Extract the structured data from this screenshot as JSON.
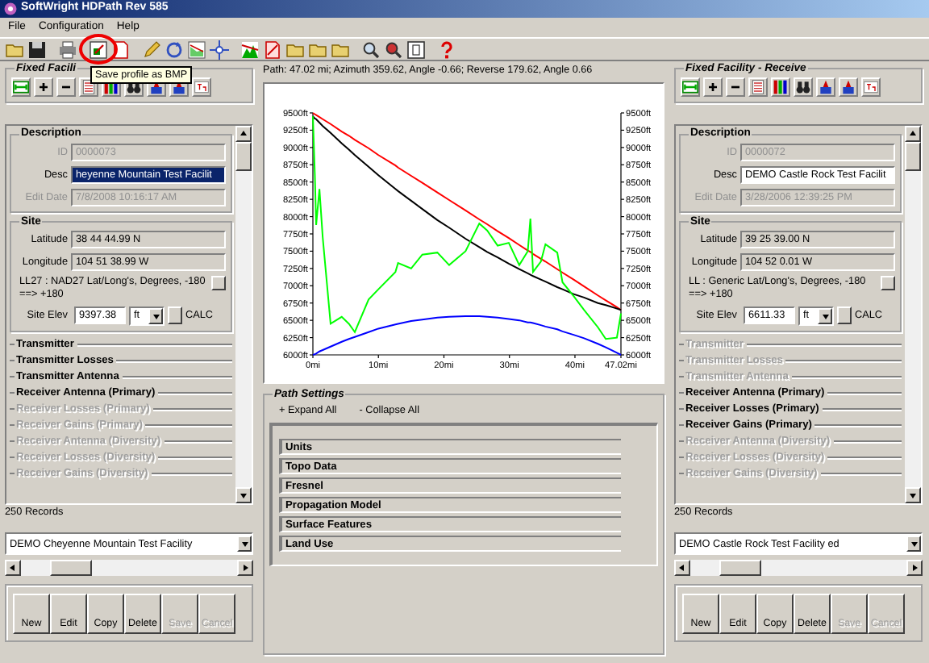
{
  "window": {
    "title": "SoftWright HDPath Rev 585"
  },
  "menu": [
    {
      "label": "File"
    },
    {
      "label": "Configuration"
    },
    {
      "label": "Help"
    }
  ],
  "toolbar": {
    "tooltip": "Save profile as BMP",
    "highlight_circle": true
  },
  "left_facility": {
    "title": "Fixed Facili",
    "description": {
      "heading": "Description",
      "fields": [
        {
          "label": "ID",
          "value": "0000073",
          "disabled": true,
          "text_selected": false
        },
        {
          "label": "Desc",
          "value": "heyenne Mountain Test Facilit",
          "disabled": false,
          "text_selected": true
        },
        {
          "label": "Edit Date",
          "value": "7/8/2008 10:16:17 AM",
          "disabled": true,
          "text_selected": false
        }
      ]
    },
    "site": {
      "heading": "Site",
      "fields": [
        {
          "label": "Latitude",
          "value": "38 44 44.99 N",
          "disabled": false,
          "readonly": true,
          "text_selected": false
        },
        {
          "label": "Longitude",
          "value": "104 51 38.99 W",
          "disabled": false,
          "readonly": true,
          "text_selected": false
        }
      ],
      "datum": "LL27 : NAD27 Lat/Long's, Degrees, -180 ==> +180",
      "elev_label": "Site Elev",
      "elev": "9397.38",
      "unit": "ft",
      "calc_label": "CALC"
    },
    "sections": [
      {
        "label": "Transmitter",
        "disabled": false
      },
      {
        "label": "Transmitter Losses",
        "disabled": false
      },
      {
        "label": "Transmitter Antenna",
        "disabled": false
      },
      {
        "label": "Receiver Antenna (Primary)",
        "disabled": false
      },
      {
        "label": "Receiver Losses (Primary)",
        "disabled": true
      },
      {
        "label": "Receiver Gains (Primary)",
        "disabled": true
      },
      {
        "label": "Receiver Antenna (Diversity)",
        "disabled": true
      },
      {
        "label": "Receiver Losses (Diversity)",
        "disabled": true
      },
      {
        "label": "Receiver Gains (Diversity)",
        "disabled": true
      }
    ],
    "records": "250 Records",
    "record": "DEMO Cheyenne Mountain Test Facility",
    "buttons": [
      {
        "label": "New",
        "disabled": false
      },
      {
        "label": "Edit",
        "disabled": false
      },
      {
        "label": "Copy",
        "disabled": false
      },
      {
        "label": "Delete",
        "disabled": false
      },
      {
        "label": "Save",
        "disabled": true
      },
      {
        "label": "Cancel",
        "disabled": true
      }
    ]
  },
  "center": {
    "path_info": "Path: 47.02 mi; Azimuth 359.62, Angle -0.66; Reverse 179.62, Angle 0.66",
    "chart": {
      "chart_data": {
        "type": "line",
        "x": [
          0,
          0.3,
          0.5,
          1,
          1.5,
          2.7,
          4.4,
          5.5,
          6.4,
          8.5,
          10,
          12.6,
          13,
          15,
          16.7,
          19,
          20.8,
          23.3,
          25.4,
          26.6,
          28.2,
          29.9,
          31.5,
          32.8,
          33.2,
          33.6,
          34.8,
          35.5,
          37.3,
          38.1,
          39.8,
          41.4,
          43.5,
          44.7,
          46.4,
          47.02
        ],
        "series": [
          {
            "color": "#ff0000",
            "values": [
              9500,
              9480,
              9470,
              9440,
              9410,
              9340,
              9230,
              9170,
              9110,
              8990,
              8890,
              8740,
              8710,
              8590,
              8490,
              8350,
              8240,
              8090,
              7960,
              7890,
              7790,
              7690,
              7590,
              7510,
              7490,
              7460,
              7390,
              7350,
              7240,
              7190,
              7090,
              6990,
              6860,
              6790,
              6690,
              6650
            ]
          },
          {
            "color": "#000000",
            "values": [
              9450,
              9420,
              9410,
              9360,
              9310,
              9210,
              9060,
              8970,
              8890,
              8720,
              8600,
              8400,
              8370,
              8230,
              8110,
              7950,
              7840,
              7680,
              7560,
              7490,
              7410,
              7320,
              7240,
              7180,
              7160,
              7140,
              7090,
              7060,
              6980,
              6950,
              6880,
              6830,
              6750,
              6720,
              6670,
              6650
            ]
          },
          {
            "color": "#00ff00",
            "values": [
              9450,
              8600,
              7880,
              8400,
              7700,
              6450,
              6550,
              6450,
              6330,
              6800,
              6950,
              7200,
              7330,
              7250,
              7450,
              7480,
              7300,
              7500,
              7900,
              7800,
              7580,
              7620,
              7300,
              7500,
              7970,
              7200,
              7350,
              7600,
              7480,
              7050,
              6850,
              6650,
              6400,
              6230,
              6250,
              6600
            ]
          },
          {
            "color": "#0000ff",
            "values": [
              6000,
              6010,
              6020,
              6050,
              6070,
              6120,
              6190,
              6230,
              6260,
              6330,
              6380,
              6440,
              6450,
              6490,
              6510,
              6540,
              6550,
              6560,
              6560,
              6550,
              6540,
              6520,
              6500,
              6470,
              6470,
              6460,
              6430,
              6410,
              6370,
              6340,
              6290,
              6240,
              6160,
              6110,
              6030,
              6000
            ]
          }
        ],
        "xlim": [
          0,
          47.02
        ],
        "ylim": [
          6000,
          9500
        ],
        "xticks": [
          {
            "value": 0,
            "label": "0mi"
          },
          {
            "value": 10,
            "label": "10mi"
          },
          {
            "value": 20,
            "label": "20mi"
          },
          {
            "value": 30,
            "label": "30mi"
          },
          {
            "value": 40,
            "label": "40mi"
          },
          {
            "value": 47.02,
            "label": "47.02mi"
          }
        ],
        "yticks": [
          {
            "value": 6000,
            "label": "6000ft"
          },
          {
            "value": 6250,
            "label": "6250ft"
          },
          {
            "value": 6500,
            "label": "6500ft"
          },
          {
            "value": 6750,
            "label": "6750ft"
          },
          {
            "value": 7000,
            "label": "7000ft"
          },
          {
            "value": 7250,
            "label": "7250ft"
          },
          {
            "value": 7500,
            "label": "7500ft"
          },
          {
            "value": 7750,
            "label": "7750ft"
          },
          {
            "value": 8000,
            "label": "8000ft"
          },
          {
            "value": 8250,
            "label": "8250ft"
          },
          {
            "value": 8500,
            "label": "8500ft"
          },
          {
            "value": 8750,
            "label": "8750ft"
          },
          {
            "value": 9000,
            "label": "9000ft"
          },
          {
            "value": 9250,
            "label": "9250ft"
          },
          {
            "value": 9500,
            "label": "9500ft"
          }
        ]
      }
    },
    "path_settings": {
      "title": "Path Settings",
      "expand_all": "+ Expand All",
      "collapse_all": "- Collapse All",
      "items": [
        {
          "label": "Units"
        },
        {
          "label": "Topo Data"
        },
        {
          "label": "Fresnel"
        },
        {
          "label": "Propagation Model"
        },
        {
          "label": "Surface Features"
        },
        {
          "label": "Land Use"
        }
      ]
    }
  },
  "right_facility": {
    "title": "Fixed Facility - Receive",
    "description": {
      "heading": "Description",
      "fields": [
        {
          "label": "ID",
          "value": "0000072",
          "disabled": true,
          "text_selected": false
        },
        {
          "label": "Desc",
          "value": "DEMO Castle Rock Test Facilit",
          "disabled": false,
          "text_selected": false
        },
        {
          "label": "Edit Date",
          "value": "3/28/2006 12:39:25 PM",
          "disabled": true,
          "text_selected": false
        }
      ]
    },
    "site": {
      "heading": "Site",
      "fields": [
        {
          "label": "Latitude",
          "value": "39 25 39.00 N",
          "disabled": false,
          "readonly": true,
          "text_selected": false
        },
        {
          "label": "Longitude",
          "value": "104 52 0.01 W",
          "disabled": false,
          "readonly": true,
          "text_selected": false
        }
      ],
      "datum": "LL : Generic Lat/Long's, Degrees, -180 ==> +180",
      "elev_label": "Site Elev",
      "elev": "6611.33",
      "unit": "ft",
      "calc_label": "CALC"
    },
    "sections": [
      {
        "label": "Transmitter",
        "disabled": true
      },
      {
        "label": "Transmitter Losses",
        "disabled": true
      },
      {
        "label": "Transmitter Antenna",
        "disabled": true
      },
      {
        "label": "Receiver Antenna (Primary)",
        "disabled": false
      },
      {
        "label": "Receiver Losses (Primary)",
        "disabled": false
      },
      {
        "label": "Receiver Gains (Primary)",
        "disabled": false
      },
      {
        "label": "Receiver Antenna (Diversity)",
        "disabled": true
      },
      {
        "label": "Receiver Losses (Diversity)",
        "disabled": true
      },
      {
        "label": "Receiver Gains (Diversity)",
        "disabled": true
      }
    ],
    "records": "250 Records",
    "record": "DEMO Castle Rock Test Facility ed",
    "buttons": [
      {
        "label": "New",
        "disabled": false
      },
      {
        "label": "Edit",
        "disabled": false
      },
      {
        "label": "Copy",
        "disabled": false
      },
      {
        "label": "Delete",
        "disabled": false
      },
      {
        "label": "Save",
        "disabled": true
      },
      {
        "label": "Cancel",
        "disabled": true
      }
    ]
  }
}
